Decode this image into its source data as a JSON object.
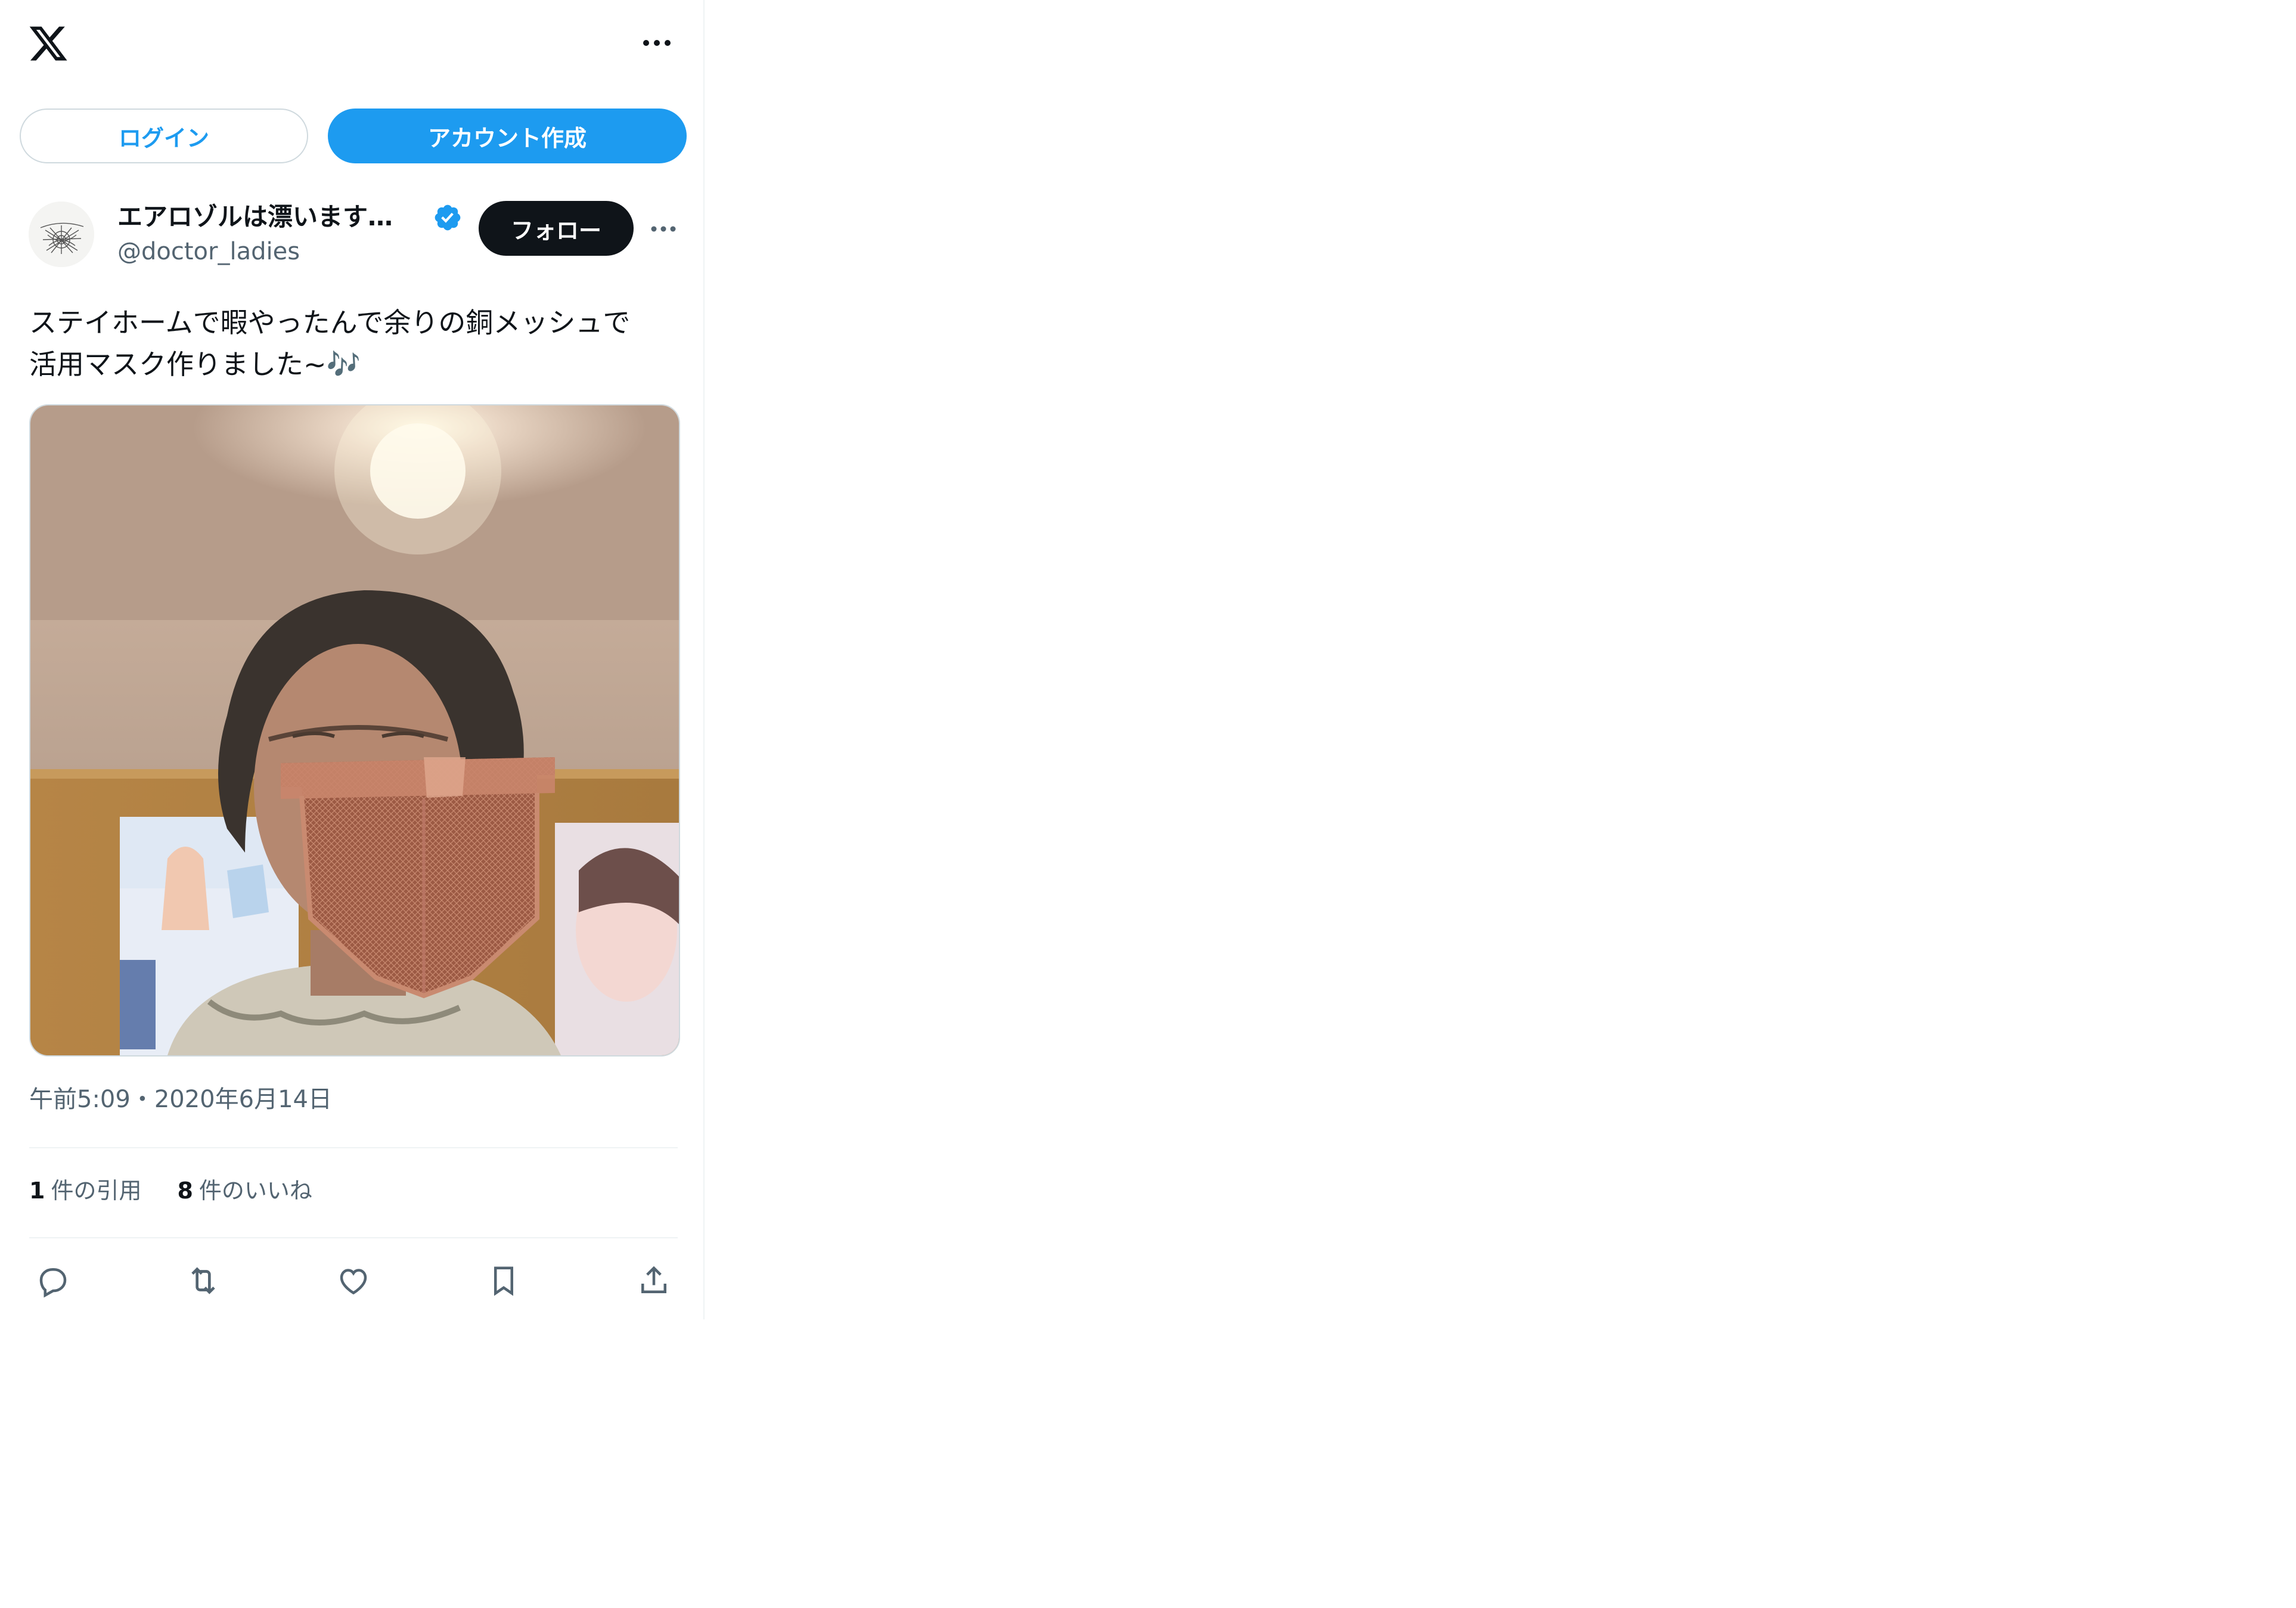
{
  "header": {
    "logo_icon": "x-logo-icon",
    "more_icon": "more-horizontal-icon"
  },
  "auth": {
    "login_label": "ログイン",
    "signup_label": "アカウント作成"
  },
  "author": {
    "display_name": "エアロゾルは漂います…",
    "handle": "@doctor_ladies",
    "verified": true,
    "follow_label": "フォロー"
  },
  "tweet": {
    "text_line1": "ステイホームで暇やったんで余りの銅メッシュで",
    "text_line2": "活用マスク作りました~",
    "emoji": "🎶",
    "timestamp": "午前5:09・2020年6月14日"
  },
  "stats": {
    "quotes_count": "1",
    "quotes_label": "件の引用",
    "likes_count": "8",
    "likes_label": "件のいいね"
  },
  "colors": {
    "accent": "#1d9bf0",
    "text": "#0f1419",
    "muted": "#536471",
    "border": "#cfd9de"
  },
  "actions": [
    "reply-icon",
    "repost-icon",
    "like-icon",
    "bookmark-icon",
    "share-icon"
  ]
}
